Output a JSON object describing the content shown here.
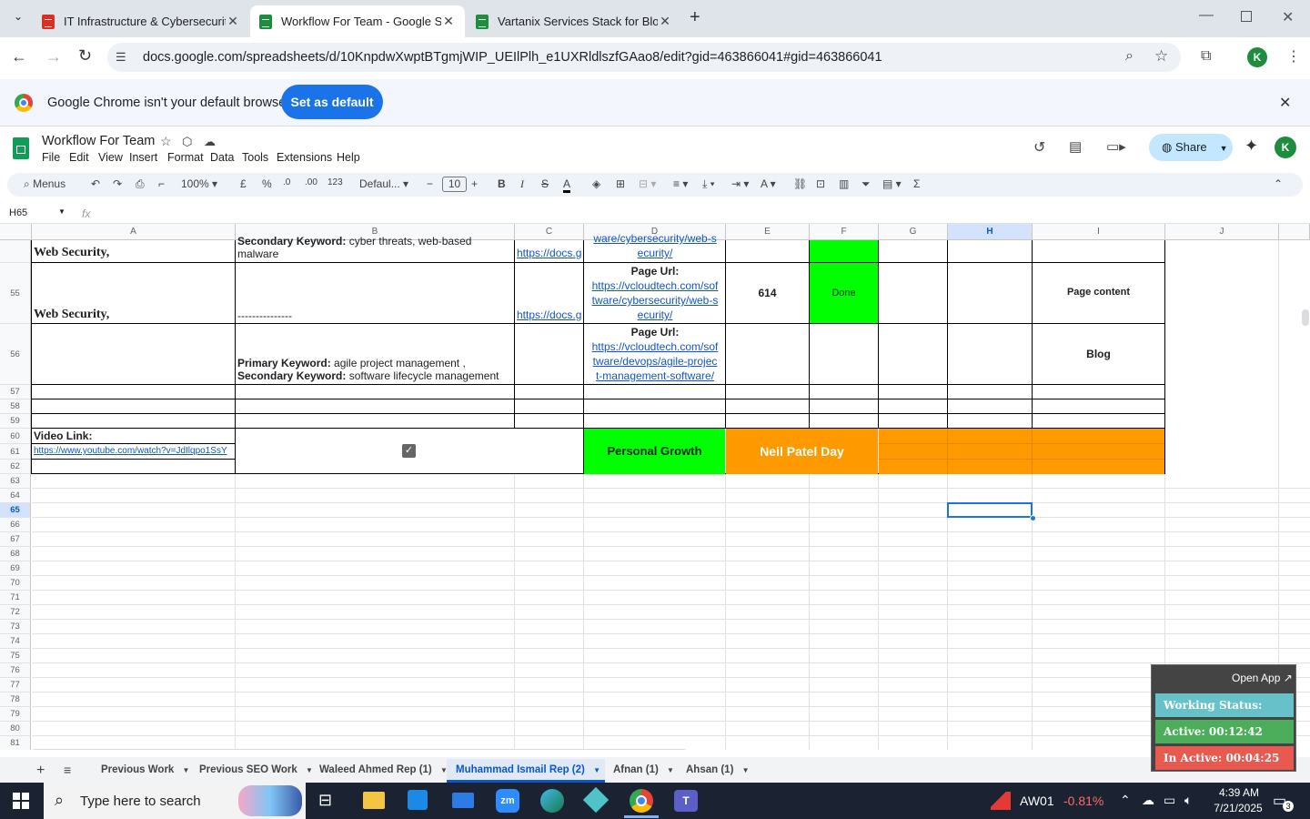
{
  "browser": {
    "tabs": [
      {
        "title": "IT Infrastructure & Cybersecurit",
        "icon": "sheets-icon"
      },
      {
        "title": "Workflow For Team - Google Sh",
        "icon": "sheets-icon"
      },
      {
        "title": "Vartanix Services Stack for Blog",
        "icon": "sheets-icon"
      }
    ],
    "url": "docs.google.com/spreadsheets/d/10KnpdwXwptBTgmjWIP_UEIlPlh_e1UXRldlszfGAao8/edit?gid=463866041#gid=463866041",
    "profile_initial": "K"
  },
  "banner": {
    "message": "Google Chrome isn't your default browser",
    "button": "Set as default"
  },
  "sheet": {
    "title": "Workflow For Team",
    "menus": [
      "File",
      "Edit",
      "View",
      "Insert",
      "Format",
      "Data",
      "Tools",
      "Extensions",
      "Help"
    ],
    "share": "Share",
    "user_initial": "K",
    "toolbar": {
      "search": "Menus",
      "zoom": "100%",
      "currency": "£",
      "percent": "%",
      "dec_dec": ".0",
      "dec_inc": ".00",
      "number": "123",
      "font": "Defaul...",
      "size": "10",
      "bold": "B",
      "italic": "I"
    },
    "name_box": "H65",
    "fx": "fx",
    "columns": [
      "A",
      "B",
      "C",
      "D",
      "E",
      "F",
      "G",
      "H",
      "I",
      "J"
    ],
    "rows": [
      "55",
      "56",
      "57",
      "58",
      "59",
      "60",
      "61",
      "62",
      "63",
      "64",
      "65",
      "66",
      "67",
      "68",
      "69",
      "70",
      "71",
      "72",
      "73",
      "74",
      "75",
      "76",
      "77",
      "78",
      "79",
      "80",
      "81"
    ],
    "cells": {
      "a54": "Web Security,",
      "b54a": "Secondary Keyword:",
      "b54b": " cyber threats, web-based",
      "b54c": "malware",
      "c54": "https://docs.g",
      "d54a": "ware/cybersecurity/web-s",
      "d54b": "ecurity/",
      "a55": "Web Security,",
      "b55": "---------------",
      "c55": "https://docs.g",
      "d55_label": "Page Url:",
      "d55_link": [
        "https://vcloudtech.com/sof",
        "tware/cybersecurity/web-s",
        "ecurity/"
      ],
      "e55": "614",
      "f55": "Done",
      "i55": "Page content",
      "b56a_label": "Primary Keyword:",
      "b56a": "  agile project management ,",
      "b56b_label": "Secondary Keyword:",
      "b56b": "  software lifecycle management",
      "d56_label": "Page Url:",
      "d56_link": [
        "https://vcloudtech.com/sof",
        "tware/devops/agile-projec",
        "t-management-software/"
      ],
      "i56": "Blog",
      "a60": "Video Link:",
      "a61": "https://www.youtube.com/watch?v=JdIlqpo1SsY",
      "d60": "Personal Growth",
      "e60": "Neil Patel Day"
    },
    "sheet_tabs": [
      "Previous Work",
      "Previous SEO Work",
      "Waleed Ahmed Rep (1)",
      "Muhammad Ismail Rep (2)",
      "Afnan (1)",
      "Ahsan (1)"
    ],
    "active_sheet": "Muhammad Ismail Rep (2)",
    "colors": {
      "green": "#00ff00",
      "orange": "#ff9900",
      "link": "#1155cc",
      "accent": "#1a73e8"
    }
  },
  "widget": {
    "open": "Open App ↗",
    "status": "Working Status: Active",
    "active": "Active: 00:12:42",
    "inactive": "In Active: 00:04:25"
  },
  "taskbar": {
    "search": "Type here to search",
    "ticker": "AW01",
    "change": "-0.81%",
    "time": "4:39 AM",
    "date": "7/21/2025",
    "notif": "3"
  }
}
